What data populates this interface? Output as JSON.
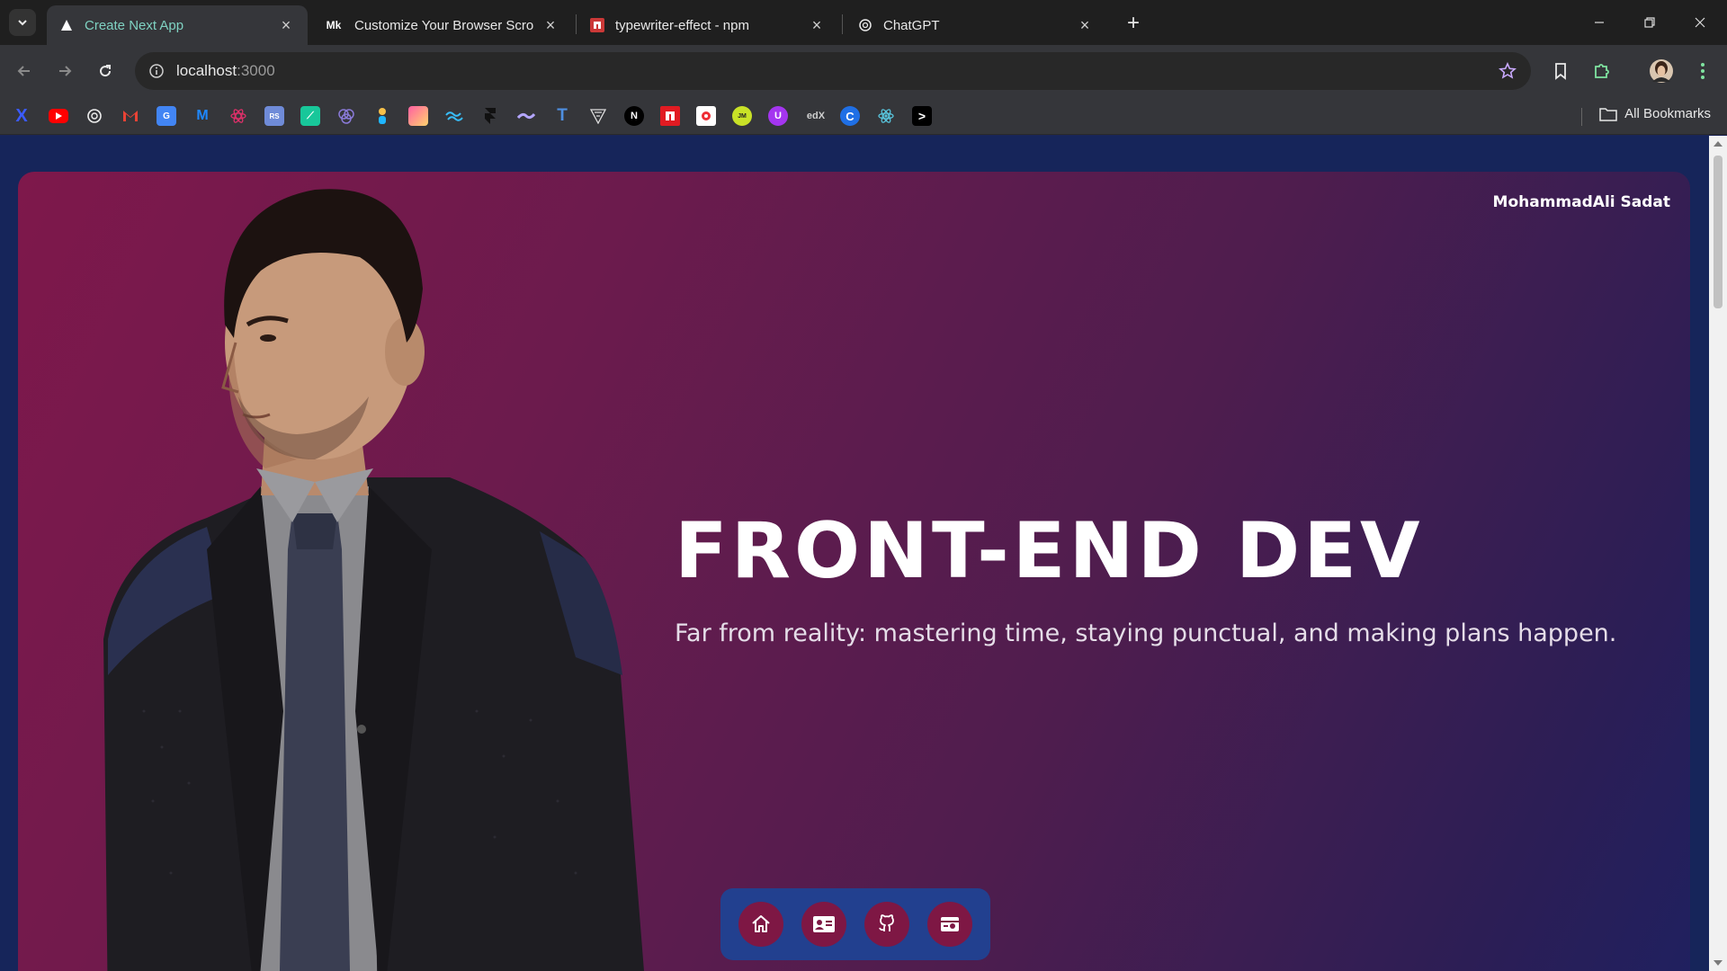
{
  "browser": {
    "tabs": [
      {
        "title": "Create Next App",
        "icon": "nextjs-icon",
        "active": true
      },
      {
        "title": "Customize Your Browser Scrollb",
        "icon": "medium-icon",
        "active": false
      },
      {
        "title": "typewriter-effect - npm",
        "icon": "npm-icon",
        "active": false
      },
      {
        "title": "ChatGPT",
        "icon": "chatgpt-icon",
        "active": false
      }
    ],
    "url_host": "localhost",
    "url_path": ":3000",
    "all_bookmarks_label": "All Bookmarks",
    "bookmark_icons": [
      "x-icon",
      "youtube-icon",
      "chatgpt-icon",
      "gmail-icon",
      "google-translate-icon",
      "mui-icon",
      "react-icon",
      "tool-icon",
      "codepen-icon",
      "framer-icon",
      "figma-icon",
      "gradient-icon",
      "tailwind-icon",
      "framer-motion-icon",
      "styled-icon",
      "typescript-icon",
      "vercel-icon",
      "nextjs-icon",
      "npm-icon",
      "vite-icon",
      "jsm-icon",
      "udemy-icon",
      "edx-icon",
      "coursera-icon",
      "react-icon",
      "terminal-icon"
    ]
  },
  "page": {
    "author": "MohammadAli Sadat",
    "headline": "FRONT-END DEV",
    "tagline": "Far from reality: mastering time, staying punctual, and making plans happen.",
    "dock": [
      "home-icon",
      "contact-card-icon",
      "github-icon",
      "portfolio-icon"
    ],
    "colors": {
      "page_bg": "#16255a",
      "hero_start": "#7e184b",
      "hero_end": "#1f2060",
      "dock_bg": "#22408f",
      "dock_button": "#7e1744",
      "accent_url": "#9a9a9a"
    }
  }
}
